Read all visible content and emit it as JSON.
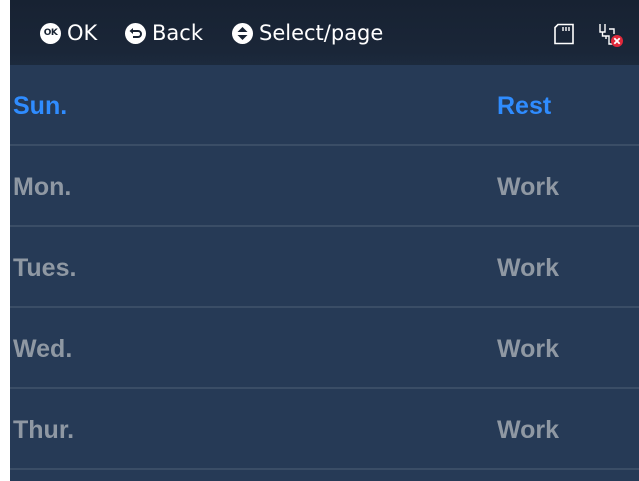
{
  "topbar": {
    "hints": [
      {
        "icon": "ok-button-icon",
        "label": "OK"
      },
      {
        "icon": "back-button-icon",
        "label": "Back"
      },
      {
        "icon": "up-down-arrows-icon",
        "label": "Select/page"
      }
    ],
    "status_icons": [
      "sd-card-icon",
      "network-disconnected-icon"
    ]
  },
  "schedule": {
    "rows": [
      {
        "day": "Sun.",
        "mode": "Rest",
        "selected": true
      },
      {
        "day": "Mon.",
        "mode": "Work",
        "selected": false
      },
      {
        "day": "Tues.",
        "mode": "Work",
        "selected": false
      },
      {
        "day": "Wed.",
        "mode": "Work",
        "selected": false
      },
      {
        "day": "Thur.",
        "mode": "Work",
        "selected": false
      }
    ]
  },
  "colors": {
    "background": "#263a56",
    "topbar": "#172232",
    "selected_text": "#2f8cff",
    "normal_text": "#8f98a3",
    "divider": "#3a4d66"
  }
}
